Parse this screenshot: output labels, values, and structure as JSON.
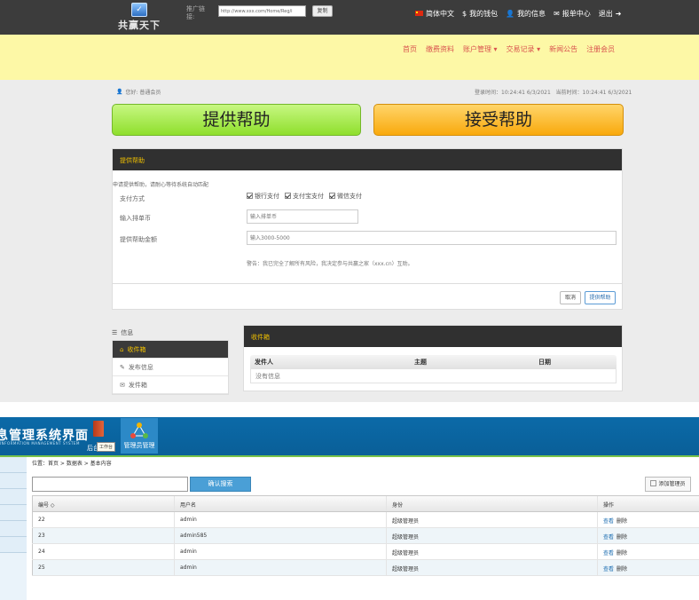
{
  "site": {
    "logo_text": "共赢天下",
    "promo_label": "推广链接:",
    "promo_url": "http://www.xxx.com/Home/Reg/i",
    "copy_label": "复制",
    "top_links": [
      {
        "icon": "china-flag-icon",
        "label": "简体中文"
      },
      {
        "icon": "dollar-icon",
        "label": "我的钱包"
      },
      {
        "icon": "user-icon",
        "label": "我的信息"
      },
      {
        "icon": "envelope-icon",
        "label": "报单中心"
      },
      {
        "icon": "logout-arrow-icon",
        "label": "退出"
      }
    ],
    "nav": [
      "首页",
      "缴费资料",
      "账户管理 ▾",
      "交易记录 ▾",
      "新闻公告",
      "注册会员"
    ]
  },
  "dashboard": {
    "user_info": "您好: 普通会员",
    "last_login": "登录时间：10:24:41 6/3/2021",
    "current_time": "当前时间：10:24:41 6/3/2021",
    "provide_button": "提供帮助",
    "accept_button": "接受帮助"
  },
  "provide_panel": {
    "title": "提供帮助",
    "hint": "申请提供帮助，请耐心等待系统自动匹配",
    "pay_label": "支付方式",
    "pay_options": [
      "银行支付",
      "支付宝支付",
      "微信支付"
    ],
    "amount_label": "输入排单币",
    "amount_placeholder": "输入排单币",
    "help_label": "提供帮助金额",
    "help_placeholder": "输入3000-5000",
    "warning": "警告：我已完全了解所有风险，我决定参与共赢之家（xxx.cn）互助。",
    "cancel": "取消",
    "submit": "提供帮助"
  },
  "sidebar_menu": {
    "title": "信息",
    "items": [
      {
        "icon": "inbox-icon",
        "label": "收件箱"
      },
      {
        "icon": "edit-icon",
        "label": "发布信息"
      },
      {
        "icon": "mail-icon",
        "label": "发件箱"
      }
    ]
  },
  "inbox": {
    "title": "收件箱",
    "columns": [
      "发件人",
      "主题",
      "日期"
    ],
    "empty_text": "没有信息"
  },
  "admin": {
    "title": "息管理系统界面",
    "subtitle": "INFORMATION MANAGEMENT SYSTEM",
    "tool_a_label": "后台",
    "tooltip": "工作台",
    "tool_b_label": "管理员管理",
    "breadcrumb": "位置：首页 > 数据表 > 基本内容",
    "search_button": "确认搜索",
    "add_button": "添加管理员",
    "table": {
      "headers": [
        "编号 ◇",
        "用户名",
        "身份",
        "操作"
      ],
      "rows": [
        {
          "id": "22",
          "user": "admin",
          "role": "超级管理员",
          "view": "查看",
          "del": "删除"
        },
        {
          "id": "23",
          "user": "admin585",
          "role": "超级管理员",
          "view": "查看",
          "del": "删除"
        },
        {
          "id": "24",
          "user": "admin",
          "role": "超级管理员",
          "view": "查看",
          "del": "删除"
        },
        {
          "id": "25",
          "user": "admin",
          "role": "超级管理员",
          "view": "查看",
          "del": "删除"
        }
      ]
    }
  },
  "colors": {
    "topbar": "#3c3c3c",
    "nav_bg": "#fdf8a6",
    "nav_link": "#d9534f",
    "provide_green": "#8fdf2c",
    "accept_orange": "#f9a90c",
    "panel_head": "#303030",
    "panel_title": "#f0c000",
    "admin_blue": "#0b6aa8"
  }
}
